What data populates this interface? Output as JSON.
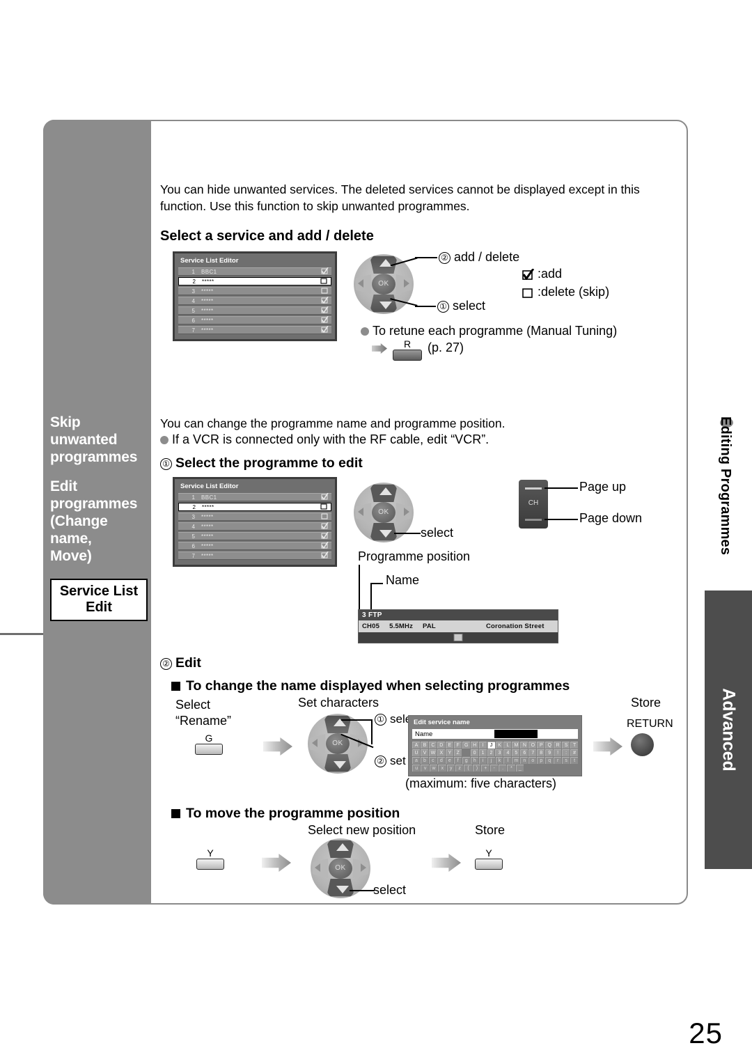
{
  "page": {
    "number": "25"
  },
  "sidebar": {
    "titles": [
      "Skip\nunwanted\nprogrammes",
      "Edit\nprogrammes\n(Change name,\n Move)"
    ],
    "title1_line1": "Skip",
    "title1_line2": "unwanted",
    "title1_line3": "programmes",
    "title2_line1": "Edit",
    "title2_line2": "programmes",
    "title2_line3": "(Change name,",
    "title2_line4": " Move)",
    "box_line1": "Service List",
    "box_line2": "Edit"
  },
  "rail": {
    "section": "Editing Programmes",
    "tab": "Advanced"
  },
  "section1": {
    "intro_line1": "You can hide unwanted services. The deleted services cannot be displayed except in this",
    "intro_line2": "function. Use this function to skip unwanted programmes.",
    "heading": "Select a service and add / delete",
    "dpad_label_top": "add / delete",
    "dpad_label_top_num": "②",
    "dpad_label_bottom": "select",
    "dpad_label_bottom_num": "①",
    "legend_add": ":add",
    "legend_delete": ":delete (skip)",
    "retune_note": "To retune each programme (Manual Tuning)",
    "retune_key": "R",
    "retune_page": "(p. 27)"
  },
  "service_list": {
    "title": "Service List Editor",
    "rows": [
      {
        "num": "1",
        "name": "BBC1",
        "checked": true
      },
      {
        "num": "2",
        "name": "*****",
        "checked": false,
        "selected": true
      },
      {
        "num": "3",
        "name": "*****",
        "checked": false
      },
      {
        "num": "4",
        "name": "*****",
        "checked": true
      },
      {
        "num": "5",
        "name": "*****",
        "checked": true
      },
      {
        "num": "6",
        "name": "*****",
        "checked": true
      },
      {
        "num": "7",
        "name": "*****",
        "checked": true
      }
    ]
  },
  "section2": {
    "intro_line1": "You can change the programme name and programme position.",
    "intro_line2": "If a VCR is connected only with the RF cable, edit “VCR”.",
    "step1_num": "①",
    "step1_heading": "Select the programme to edit",
    "dpad_label": "select",
    "ch_label": "CH",
    "page_up": "Page up",
    "page_down": "Page down",
    "callout_position": "Programme position",
    "callout_name": "Name"
  },
  "banner": {
    "pos": "3",
    "name": "FTP",
    "channel": "CH05",
    "freq": "5.5MHz",
    "system": "PAL",
    "programme": "Coronation Street"
  },
  "section3": {
    "step2_num": "②",
    "step2_heading": "Edit",
    "sub1_heading": "To change the name displayed when selecting programmes",
    "select_line1": "Select",
    "select_line2": "“Rename”",
    "green_key": "G",
    "set_characters": "Set characters",
    "dpad_select_num": "①",
    "dpad_select": "select",
    "dpad_set_num": "②",
    "dpad_set": "set",
    "store": "Store",
    "return_label": "RETURN",
    "max_chars": "(maximum: five characters)",
    "sub2_heading": "To move the programme position",
    "yellow_key": "Y",
    "select_new_position": "Select new position",
    "move_select": "select",
    "move_store": "Store",
    "move_store_key": "Y"
  },
  "keyboard": {
    "title": "Edit service name",
    "name_label": "Name",
    "rows": [
      {
        "keys": [
          "A",
          "B",
          "C",
          "D",
          "E",
          "F",
          "G",
          "H",
          "I",
          "J",
          "K",
          "L",
          "M",
          "N",
          "O",
          "P",
          "Q",
          "R",
          "S",
          "T"
        ],
        "case": "uc",
        "selected": "J"
      },
      {
        "keys": [
          "U",
          "V",
          "W",
          "X",
          "Y",
          "Z",
          "",
          "0",
          "1",
          "2",
          "3",
          "4",
          "5",
          "6",
          "7",
          "8",
          "9",
          "!",
          ":",
          "#"
        ],
        "case": "uc"
      },
      {
        "keys": [
          "a",
          "b",
          "c",
          "d",
          "e",
          "f",
          "g",
          "h",
          "i",
          "j",
          "k",
          "l",
          "m",
          "n",
          "o",
          "p",
          "q",
          "r",
          "s",
          "t"
        ],
        "case": "lc"
      },
      {
        "keys": [
          "u",
          "v",
          "w",
          "x",
          "y",
          "z",
          "(",
          ")",
          "+",
          "-",
          ".",
          "*",
          "_"
        ],
        "case": "lc"
      }
    ]
  }
}
